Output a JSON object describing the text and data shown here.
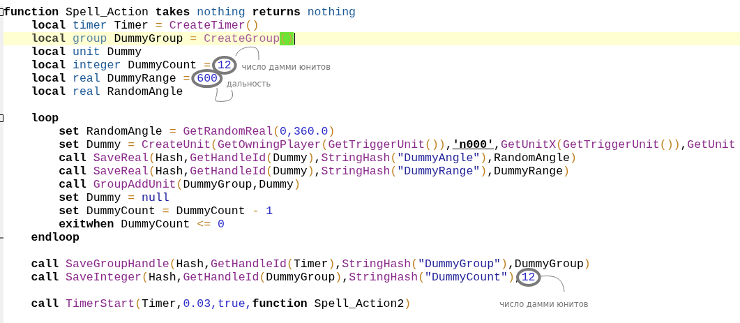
{
  "editor": {
    "lines": [
      {
        "kind": "fold_start",
        "tokens": [
          {
            "kind": "keyword",
            "text": "function"
          },
          {
            "kind": "plain",
            "text": "Spell_Action",
            "space_before": true
          },
          {
            "kind": "keyword",
            "text": "takes",
            "space_before": true
          },
          {
            "kind": "type",
            "text": "nothing",
            "space_before": true
          },
          {
            "kind": "keyword",
            "text": "returns",
            "space_before": true
          },
          {
            "kind": "type",
            "text": "nothing",
            "space_before": true
          }
        ],
        "children": [
          {
            "kind": "code",
            "tokens": [
              {
                "kind": "keyword",
                "text": "local"
              },
              {
                "kind": "type",
                "text": "timer",
                "space_before": true
              },
              {
                "kind": "plain",
                "text": "Timer",
                "space_before": true
              },
              {
                "kind": "operator",
                "text": "=",
                "space_before": true
              },
              {
                "kind": "function",
                "text": "CreateTimer",
                "space_before": true
              },
              {
                "kind": "operator",
                "text": "()"
              }
            ]
          },
          {
            "kind": "code",
            "current": true,
            "tokens": [
              {
                "kind": "keyword",
                "text": "local"
              },
              {
                "kind": "type",
                "text": "group",
                "space_before": true
              },
              {
                "kind": "plain",
                "text": "DummyGroup",
                "space_before": true
              },
              {
                "kind": "operator",
                "text": "=",
                "space_before": true
              },
              {
                "kind": "function",
                "text": "CreateGroup",
                "space_before": true
              },
              {
                "kind": "operator",
                "text": "()",
                "matched": true,
                "caret": true
              }
            ]
          },
          {
            "kind": "code",
            "tokens": [
              {
                "kind": "keyword",
                "text": "local"
              },
              {
                "kind": "type",
                "text": "unit",
                "space_before": true
              },
              {
                "kind": "plain",
                "text": "Dummy",
                "space_before": true
              }
            ]
          },
          {
            "kind": "code",
            "tokens": [
              {
                "kind": "keyword",
                "text": "local"
              },
              {
                "kind": "type",
                "text": "integer",
                "space_before": true
              },
              {
                "kind": "plain",
                "text": "DummyCount",
                "space_before": true
              },
              {
                "kind": "operator",
                "text": "=",
                "space_before": true
              },
              {
                "kind": "number",
                "text": "12",
                "space_before": true,
                "circled": true,
                "note": {
                  "kind": "right",
                  "text": "число дамми юнитов"
                }
              }
            ]
          },
          {
            "kind": "code",
            "tokens": [
              {
                "kind": "keyword",
                "text": "local"
              },
              {
                "kind": "type",
                "text": "real",
                "space_before": true
              },
              {
                "kind": "plain",
                "text": "DummyRange",
                "space_before": true
              },
              {
                "kind": "operator",
                "text": "=",
                "space_before": true
              },
              {
                "kind": "number",
                "text": "600",
                "space_before": true,
                "circled": true,
                "note": {
                  "kind": "below",
                  "text": "дальность"
                }
              }
            ]
          },
          {
            "kind": "code",
            "tokens": [
              {
                "kind": "keyword",
                "text": "local"
              },
              {
                "kind": "type",
                "text": "real",
                "space_before": true
              },
              {
                "kind": "plain",
                "text": "RandomAngle",
                "space_before": true
              }
            ]
          },
          {
            "kind": "blank"
          },
          {
            "kind": "fold_start",
            "tokens": [
              {
                "kind": "keyword",
                "text": "loop"
              }
            ],
            "children": [
              {
                "kind": "code",
                "tokens": [
                  {
                    "kind": "keyword",
                    "text": "set"
                  },
                  {
                    "kind": "plain",
                    "text": "RandomAngle",
                    "space_before": true
                  },
                  {
                    "kind": "operator",
                    "text": "=",
                    "space_before": true
                  },
                  {
                    "kind": "function",
                    "text": "GetRandomReal",
                    "space_before": true
                  },
                  {
                    "kind": "operator",
                    "text": "("
                  },
                  {
                    "kind": "number",
                    "text": "0,360.0"
                  },
                  {
                    "kind": "operator",
                    "text": ")"
                  }
                ]
              },
              {
                "kind": "code",
                "tokens": [
                  {
                    "kind": "keyword",
                    "text": "set"
                  },
                  {
                    "kind": "plain",
                    "text": "Dummy",
                    "space_before": true
                  },
                  {
                    "kind": "operator",
                    "text": "=",
                    "space_before": true
                  },
                  {
                    "kind": "function",
                    "text": "CreateUnit",
                    "space_before": true
                  },
                  {
                    "kind": "operator",
                    "text": "("
                  },
                  {
                    "kind": "function",
                    "text": "GetOwningPlayer"
                  },
                  {
                    "kind": "operator",
                    "text": "("
                  },
                  {
                    "kind": "function",
                    "text": "GetTriggerUnit"
                  },
                  {
                    "kind": "operator",
                    "text": "())"
                  },
                  {
                    "kind": "plain",
                    "text": ","
                  },
                  {
                    "kind": "rawcode",
                    "text": "'n000'"
                  },
                  {
                    "kind": "plain",
                    "text": ","
                  },
                  {
                    "kind": "function",
                    "text": "GetUnitX"
                  },
                  {
                    "kind": "operator",
                    "text": "("
                  },
                  {
                    "kind": "function",
                    "text": "GetTriggerUnit"
                  },
                  {
                    "kind": "operator",
                    "text": "())"
                  },
                  {
                    "kind": "plain",
                    "text": ","
                  },
                  {
                    "kind": "function",
                    "text": "GetUnit"
                  }
                ]
              },
              {
                "kind": "code",
                "tokens": [
                  {
                    "kind": "keyword",
                    "text": "call"
                  },
                  {
                    "kind": "function",
                    "text": "SaveReal",
                    "space_before": true
                  },
                  {
                    "kind": "operator",
                    "text": "("
                  },
                  {
                    "kind": "plain",
                    "text": "Hash,"
                  },
                  {
                    "kind": "function",
                    "text": "GetHandleId"
                  },
                  {
                    "kind": "operator",
                    "text": "("
                  },
                  {
                    "kind": "plain",
                    "text": "Dummy"
                  },
                  {
                    "kind": "operator",
                    "text": ")"
                  },
                  {
                    "kind": "plain",
                    "text": ","
                  },
                  {
                    "kind": "function",
                    "text": "StringHash"
                  },
                  {
                    "kind": "operator",
                    "text": "("
                  },
                  {
                    "kind": "string",
                    "text": "\"DummyAngle\""
                  },
                  {
                    "kind": "operator",
                    "text": ")"
                  },
                  {
                    "kind": "plain",
                    "text": ",RandomAngle"
                  },
                  {
                    "kind": "operator",
                    "text": ")"
                  }
                ]
              },
              {
                "kind": "code",
                "tokens": [
                  {
                    "kind": "keyword",
                    "text": "call"
                  },
                  {
                    "kind": "function",
                    "text": "SaveReal",
                    "space_before": true
                  },
                  {
                    "kind": "operator",
                    "text": "("
                  },
                  {
                    "kind": "plain",
                    "text": "Hash,"
                  },
                  {
                    "kind": "function",
                    "text": "GetHandleId"
                  },
                  {
                    "kind": "operator",
                    "text": "("
                  },
                  {
                    "kind": "plain",
                    "text": "Dummy"
                  },
                  {
                    "kind": "operator",
                    "text": ")"
                  },
                  {
                    "kind": "plain",
                    "text": ","
                  },
                  {
                    "kind": "function",
                    "text": "StringHash"
                  },
                  {
                    "kind": "operator",
                    "text": "("
                  },
                  {
                    "kind": "string",
                    "text": "\"DummyRange\""
                  },
                  {
                    "kind": "operator",
                    "text": ")"
                  },
                  {
                    "kind": "plain",
                    "text": ",DummyRange"
                  },
                  {
                    "kind": "operator",
                    "text": ")"
                  }
                ]
              },
              {
                "kind": "code",
                "tokens": [
                  {
                    "kind": "keyword",
                    "text": "call"
                  },
                  {
                    "kind": "function",
                    "text": "GroupAddUnit",
                    "space_before": true
                  },
                  {
                    "kind": "operator",
                    "text": "("
                  },
                  {
                    "kind": "plain",
                    "text": "DummyGroup,Dummy"
                  },
                  {
                    "kind": "operator",
                    "text": ")"
                  }
                ]
              },
              {
                "kind": "code",
                "tokens": [
                  {
                    "kind": "keyword",
                    "text": "set"
                  },
                  {
                    "kind": "plain",
                    "text": "Dummy",
                    "space_before": true
                  },
                  {
                    "kind": "operator",
                    "text": "=",
                    "space_before": true
                  },
                  {
                    "kind": "constant",
                    "text": "null",
                    "space_before": true
                  }
                ]
              },
              {
                "kind": "code",
                "tokens": [
                  {
                    "kind": "keyword",
                    "text": "set"
                  },
                  {
                    "kind": "plain",
                    "text": "DummyCount",
                    "space_before": true
                  },
                  {
                    "kind": "operator",
                    "text": "=",
                    "space_before": true
                  },
                  {
                    "kind": "plain",
                    "text": "DummyCount",
                    "space_before": true
                  },
                  {
                    "kind": "operator",
                    "text": "-",
                    "space_before": true
                  },
                  {
                    "kind": "number",
                    "text": "1",
                    "space_before": true
                  }
                ]
              },
              {
                "kind": "code",
                "tokens": [
                  {
                    "kind": "keyword",
                    "text": "exitwhen"
                  },
                  {
                    "kind": "plain",
                    "text": "DummyCount",
                    "space_before": true
                  },
                  {
                    "kind": "operator",
                    "text": "<=",
                    "space_before": true
                  },
                  {
                    "kind": "number",
                    "text": "0",
                    "space_before": true
                  }
                ]
              }
            ]
          },
          {
            "kind": "fold_end",
            "tokens": [
              {
                "kind": "keyword",
                "text": "endloop"
              }
            ]
          },
          {
            "kind": "blank"
          },
          {
            "kind": "code",
            "tokens": [
              {
                "kind": "keyword",
                "text": "call"
              },
              {
                "kind": "function",
                "text": "SaveGroupHandle",
                "space_before": true
              },
              {
                "kind": "operator",
                "text": "("
              },
              {
                "kind": "plain",
                "text": "Hash,"
              },
              {
                "kind": "function",
                "text": "GetHandleId"
              },
              {
                "kind": "operator",
                "text": "("
              },
              {
                "kind": "plain",
                "text": "Timer"
              },
              {
                "kind": "operator",
                "text": ")"
              },
              {
                "kind": "plain",
                "text": ","
              },
              {
                "kind": "function",
                "text": "StringHash"
              },
              {
                "kind": "operator",
                "text": "("
              },
              {
                "kind": "string",
                "text": "\"DummyGroup\""
              },
              {
                "kind": "operator",
                "text": ")"
              },
              {
                "kind": "plain",
                "text": ",DummyGroup"
              },
              {
                "kind": "operator",
                "text": ")"
              }
            ]
          },
          {
            "kind": "code",
            "tokens": [
              {
                "kind": "keyword",
                "text": "call"
              },
              {
                "kind": "function",
                "text": "SaveInteger",
                "space_before": true
              },
              {
                "kind": "operator",
                "text": "("
              },
              {
                "kind": "plain",
                "text": "Hash,"
              },
              {
                "kind": "function",
                "text": "GetHandleId"
              },
              {
                "kind": "operator",
                "text": "("
              },
              {
                "kind": "plain",
                "text": "DummyGroup"
              },
              {
                "kind": "operator",
                "text": ")"
              },
              {
                "kind": "plain",
                "text": ","
              },
              {
                "kind": "function",
                "text": "StringHash"
              },
              {
                "kind": "operator",
                "text": "("
              },
              {
                "kind": "string",
                "text": "\"DummyCount\""
              },
              {
                "kind": "operator",
                "text": ")"
              },
              {
                "kind": "plain",
                "text": ","
              },
              {
                "kind": "number",
                "text": "12",
                "circled": true,
                "note": {
                  "kind": "below_left",
                  "text": "число дамми юнитов"
                }
              }
            ]
          },
          {
            "kind": "blank"
          },
          {
            "kind": "code",
            "tokens": [
              {
                "kind": "keyword",
                "text": "call"
              },
              {
                "kind": "function",
                "text": "TimerStart",
                "space_before": true
              },
              {
                "kind": "operator",
                "text": "("
              },
              {
                "kind": "plain",
                "text": "Timer,"
              },
              {
                "kind": "number",
                "text": "0.03,true,"
              },
              {
                "kind": "keyword",
                "text": "function"
              },
              {
                "kind": "plain",
                "text": "Spell_Action2",
                "space_before": true
              },
              {
                "kind": "operator",
                "text": ")"
              }
            ]
          }
        ]
      }
    ]
  }
}
